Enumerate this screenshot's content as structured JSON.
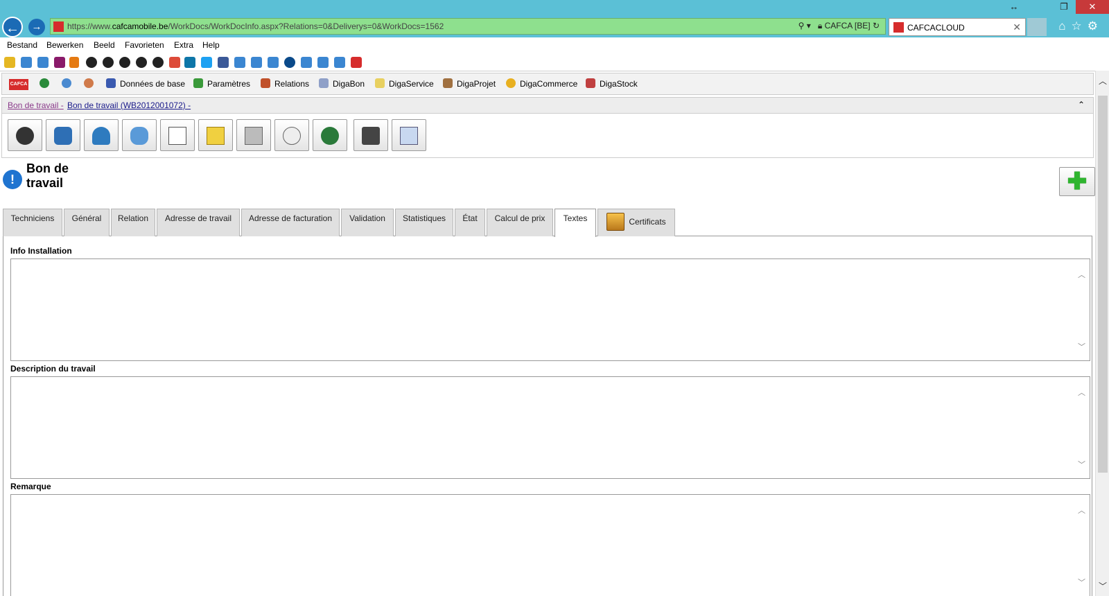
{
  "browser": {
    "url_prefix": "https://www.",
    "url_domain": "cafcamobile.be",
    "url_path": "/WorkDocs/WorkDocInfo.aspx?Relations=0&Deliverys=0&WorkDocs=1562",
    "site_identity": "CAFCA [BE]",
    "tab_title": "CAFCACLOUD",
    "menu": [
      "Bestand",
      "Bewerken",
      "Beeld",
      "Favorieten",
      "Extra",
      "Help"
    ]
  },
  "app": {
    "logo_text": "CAFCA",
    "toolbar": [
      "Données de base",
      "Paramètres",
      "Relations",
      "DigaBon",
      "DigaService",
      "DigaProjet",
      "DigaCommerce",
      "DigaStock"
    ],
    "breadcrumb": {
      "part1": "Bon de travail -",
      "part2": "Bon de travail (WB2012001072) -"
    },
    "page_title": "Bon de travail",
    "tabs": [
      "Techniciens",
      "Général",
      "Relation",
      "Adresse de travail",
      "Adresse de facturation",
      "Validation",
      "Statistiques",
      "État",
      "Calcul de prix",
      "Textes",
      "Certificats"
    ],
    "active_tab": "Textes",
    "fields": {
      "info_installation": {
        "label": "Info Installation",
        "value": ""
      },
      "description": {
        "label": "Description du travail",
        "value": ""
      },
      "remarque": {
        "label": "Remarque",
        "value": ""
      }
    }
  },
  "icons": {
    "titlebar": [
      "resize-icon",
      "restore-icon",
      "close-icon"
    ],
    "nav": [
      "back-icon",
      "forward-icon"
    ],
    "browser_right": [
      "home-icon",
      "star-icon",
      "gear-icon"
    ],
    "bigbuttons": [
      "exclamation-icon",
      "car-icon",
      "person-icon",
      "plug-bulb-icon",
      "document-icon",
      "folder-icon",
      "printer-icon",
      "clock-doc-icon",
      "globe-icon",
      "c-icon",
      "doc-gear-icon"
    ]
  }
}
